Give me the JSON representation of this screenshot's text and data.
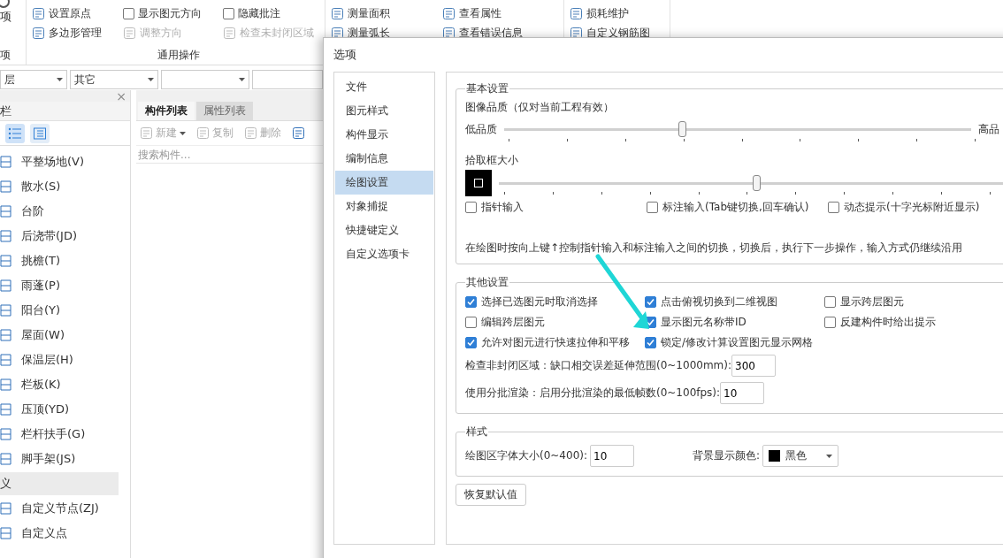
{
  "ribbon": {
    "cut_tool_label": "项",
    "cut_group_label": "项",
    "groups": [
      {
        "label": "通用操作",
        "items": [
          {
            "kind": "button",
            "label": "设置原点",
            "disabled": false
          },
          {
            "kind": "button",
            "label": "多边形管理",
            "disabled": false
          },
          {
            "kind": "checkbox",
            "label": "显示图元方向",
            "checked": false,
            "disabled": false
          },
          {
            "kind": "button",
            "label": "调整方向",
            "disabled": true
          },
          {
            "kind": "checkbox",
            "label": "隐藏批注",
            "checked": false,
            "disabled": false
          },
          {
            "kind": "button",
            "label": "检查未封闭区域",
            "disabled": true
          }
        ]
      },
      {
        "items": [
          {
            "kind": "button",
            "label": "测量面积",
            "disabled": false
          },
          {
            "kind": "button",
            "label": "测量弧长",
            "disabled": false
          },
          {
            "kind": "button",
            "label": "查看属性",
            "disabled": false
          },
          {
            "kind": "button",
            "label": "查看错误信息",
            "disabled": false
          }
        ]
      },
      {
        "items": [
          {
            "kind": "button",
            "label": "损耗维护",
            "disabled": false
          },
          {
            "kind": "button",
            "label": "自定义钢筋图",
            "disabled": false
          }
        ]
      }
    ]
  },
  "filters": [
    {
      "value": "层"
    },
    {
      "value": "其它"
    }
  ],
  "nav_panel": {
    "title": "栏",
    "close": "×",
    "view_buttons": [
      {
        "selected": true
      },
      {
        "selected": false
      }
    ],
    "items": [
      {
        "kind": "item",
        "label": "平整场地(V)"
      },
      {
        "kind": "item",
        "label": "散水(S)"
      },
      {
        "kind": "item",
        "label": "台阶"
      },
      {
        "kind": "item",
        "label": "后浇带(JD)"
      },
      {
        "kind": "item",
        "label": "挑檐(T)"
      },
      {
        "kind": "item",
        "label": "雨蓬(P)"
      },
      {
        "kind": "item",
        "label": "阳台(Y)"
      },
      {
        "kind": "item",
        "label": "屋面(W)"
      },
      {
        "kind": "item",
        "label": "保温层(H)"
      },
      {
        "kind": "item",
        "label": "栏板(K)"
      },
      {
        "kind": "item",
        "label": "压顶(YD)"
      },
      {
        "kind": "item",
        "label": "栏杆扶手(G)"
      },
      {
        "kind": "item",
        "label": "脚手架(JS)"
      },
      {
        "kind": "section",
        "label": "义"
      },
      {
        "kind": "item",
        "label": "自定义节点(ZJ)"
      },
      {
        "kind": "item",
        "label": "自定义点"
      }
    ]
  },
  "list_panel": {
    "tabs": [
      {
        "label": "构件列表",
        "selected": true
      },
      {
        "label": "属性列表",
        "selected": false
      }
    ],
    "toolbar": [
      {
        "label": "新建",
        "dropdown": true
      },
      {
        "label": "复制",
        "dropdown": false
      },
      {
        "label": "删除",
        "dropdown": false
      }
    ],
    "search": {
      "placeholder": "搜索构件..."
    }
  },
  "dialog": {
    "title": "选项",
    "nav": [
      {
        "label": "文件",
        "selected": false
      },
      {
        "label": "图元样式",
        "selected": false
      },
      {
        "label": "构件显示",
        "selected": false
      },
      {
        "label": "编制信息",
        "selected": false
      },
      {
        "label": "绘图设置",
        "selected": true
      },
      {
        "label": "对象捕捉",
        "selected": false
      },
      {
        "label": "快捷键定义",
        "selected": false
      },
      {
        "label": "自定义选项卡",
        "selected": false
      }
    ],
    "basic": {
      "title": "基本设置",
      "quality_label": "图像品质（仅对当前工程有效）",
      "quality_low": "低品质",
      "quality_high": "高品",
      "quality": {
        "level": 0.38
      },
      "pick_label": "拾取框大小",
      "pick": {
        "level": 0.455
      },
      "options": [
        {
          "label": "指针输入",
          "checked": false
        },
        {
          "label": "标注输入(Tab键切换,回车确认)",
          "checked": false
        },
        {
          "label": "动态提示(十字光标附近显示)",
          "checked": false
        }
      ],
      "note": "在绘图时按向上键↑控制指针输入和标注输入之间的切换，切换后，执行下一步操作，输入方式仍继续沿用"
    },
    "other": {
      "title": "其他设置",
      "options": [
        {
          "label": "选择已选图元时取消选择",
          "checked": true
        },
        {
          "label": "点击俯视切换到二维视图",
          "checked": true
        },
        {
          "label": "显示跨层图元",
          "checked": false
        },
        {
          "label": "编辑跨层图元",
          "checked": false
        },
        {
          "label": "显示图元名称带ID",
          "checked": true
        },
        {
          "label": "反建构件时给出提示",
          "checked": false
        },
        {
          "label": "允许对图元进行快速拉伸和平移",
          "checked": true
        },
        {
          "label": "锁定/修改计算设置图元显示网格",
          "checked": true
        }
      ],
      "fields": [
        {
          "label": "检查非封闭区域：缺口相交误差延伸范围(0~1000mm):",
          "value": "300"
        },
        {
          "label": "使用分批渲染：启用分批渲染的最低帧数(0~100fps):",
          "value": "10"
        }
      ]
    },
    "style": {
      "title": "样式",
      "font_label": "绘图区字体大小(0~400):",
      "font_value": "10",
      "bg_label": "背景显示颜色:",
      "bg_value": "黑色"
    },
    "reset_button": "恢复默认值"
  }
}
